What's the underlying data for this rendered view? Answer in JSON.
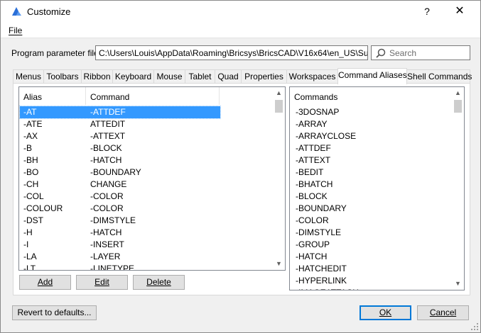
{
  "window": {
    "title": "Customize",
    "help_glyph": "?",
    "close_glyph": "✕"
  },
  "menu": {
    "file": "File"
  },
  "param": {
    "label": "Program parameter file:",
    "value": "C:\\Users\\Louis\\AppData\\Roaming\\Bricsys\\BricsCAD\\V16x64\\en_US\\Support\\de"
  },
  "search": {
    "placeholder": "Search"
  },
  "tabs": [
    "Menus",
    "Toolbars",
    "Ribbon",
    "Keyboard",
    "Mouse",
    "Tablet",
    "Quad",
    "Properties",
    "Workspaces",
    "Command Aliases",
    "Shell Commands"
  ],
  "active_tab": "Command Aliases",
  "aliases": {
    "col_alias": "Alias",
    "col_command": "Command",
    "rows": [
      {
        "alias": "-AT",
        "command": "-ATTDEF",
        "selected": true
      },
      {
        "alias": "-ATE",
        "command": "ATTEDIT"
      },
      {
        "alias": "-AX",
        "command": "-ATTEXT"
      },
      {
        "alias": "-B",
        "command": "-BLOCK"
      },
      {
        "alias": "-BH",
        "command": "-HATCH"
      },
      {
        "alias": "-BO",
        "command": "-BOUNDARY"
      },
      {
        "alias": "-CH",
        "command": "CHANGE"
      },
      {
        "alias": "-COL",
        "command": "-COLOR"
      },
      {
        "alias": "-COLOUR",
        "command": "-COLOR"
      },
      {
        "alias": "-DST",
        "command": "-DIMSTYLE"
      },
      {
        "alias": "-H",
        "command": "-HATCH"
      },
      {
        "alias": "-I",
        "command": "-INSERT"
      },
      {
        "alias": "-LA",
        "command": "-LAYER"
      },
      {
        "alias": "-LT",
        "command": "-LINETYPE"
      }
    ]
  },
  "commands": {
    "header": "Commands",
    "items": [
      "-3DOSNAP",
      "-ARRAY",
      "-ARRAYCLOSE",
      "-ATTDEF",
      "-ATTEXT",
      "-BEDIT",
      "-BHATCH",
      "-BLOCK",
      "-BOUNDARY",
      "-COLOR",
      "-DIMSTYLE",
      "-GROUP",
      "-HATCH",
      "-HATCHEDIT",
      "-HYPERLINK",
      "-IMAGEATTACH"
    ]
  },
  "buttons": {
    "add": "Add",
    "edit": "Edit",
    "delete": "Delete",
    "revert": "Revert to defaults...",
    "ok": "OK",
    "cancel": "Cancel"
  },
  "colors": {
    "selection": "#3399ff",
    "accent": "#0078d7",
    "brand_icon": "#2a6fd8"
  }
}
